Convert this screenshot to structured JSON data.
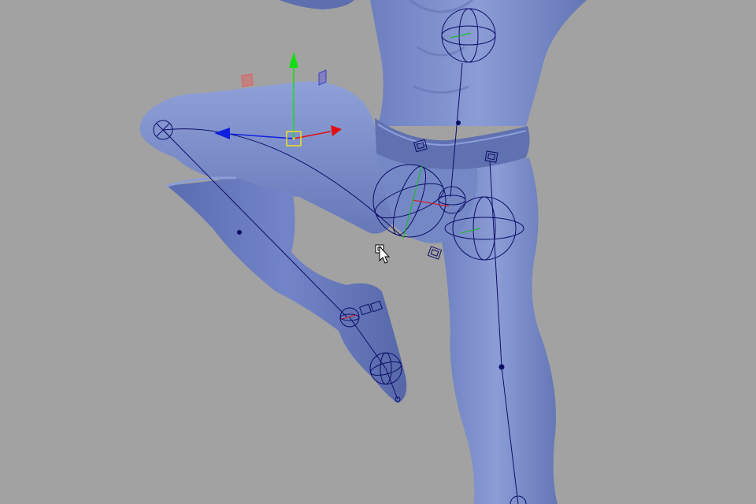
{
  "viewport": {
    "background": "#a2a2a2",
    "mesh_color": "#7d8fc9",
    "mesh_shadow": "#5e70ad",
    "rig_color": "#0d0d66",
    "axis_x_color": "#e01010",
    "axis_y_color": "#10e010",
    "axis_z_color": "#1020e0",
    "selection_color": "#f0e020",
    "plane_x_color": "#e06060",
    "plane_z_color": "#6060e0"
  },
  "manipulator": {
    "type": "move-tool",
    "axes": [
      "x",
      "y",
      "z"
    ]
  },
  "cursor": {
    "icon": "arrow-with-move-badge"
  }
}
